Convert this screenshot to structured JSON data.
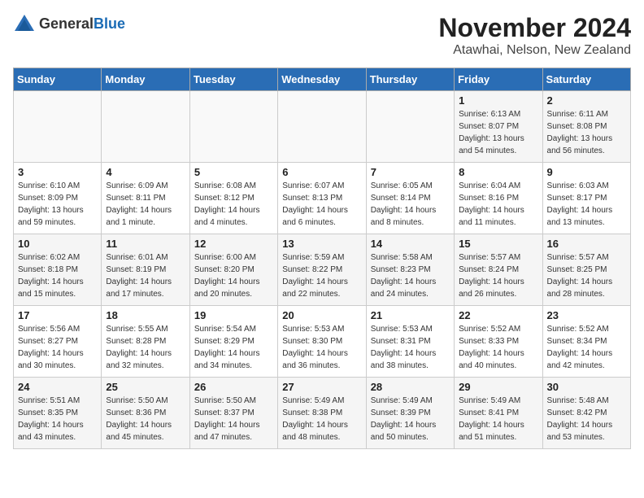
{
  "logo": {
    "text_general": "General",
    "text_blue": "Blue"
  },
  "title": "November 2024",
  "location": "Atawhai, Nelson, New Zealand",
  "days_of_week": [
    "Sunday",
    "Monday",
    "Tuesday",
    "Wednesday",
    "Thursday",
    "Friday",
    "Saturday"
  ],
  "weeks": [
    [
      {
        "day": "",
        "info": ""
      },
      {
        "day": "",
        "info": ""
      },
      {
        "day": "",
        "info": ""
      },
      {
        "day": "",
        "info": ""
      },
      {
        "day": "",
        "info": ""
      },
      {
        "day": "1",
        "info": "Sunrise: 6:13 AM\nSunset: 8:07 PM\nDaylight: 13 hours\nand 54 minutes."
      },
      {
        "day": "2",
        "info": "Sunrise: 6:11 AM\nSunset: 8:08 PM\nDaylight: 13 hours\nand 56 minutes."
      }
    ],
    [
      {
        "day": "3",
        "info": "Sunrise: 6:10 AM\nSunset: 8:09 PM\nDaylight: 13 hours\nand 59 minutes."
      },
      {
        "day": "4",
        "info": "Sunrise: 6:09 AM\nSunset: 8:11 PM\nDaylight: 14 hours\nand 1 minute."
      },
      {
        "day": "5",
        "info": "Sunrise: 6:08 AM\nSunset: 8:12 PM\nDaylight: 14 hours\nand 4 minutes."
      },
      {
        "day": "6",
        "info": "Sunrise: 6:07 AM\nSunset: 8:13 PM\nDaylight: 14 hours\nand 6 minutes."
      },
      {
        "day": "7",
        "info": "Sunrise: 6:05 AM\nSunset: 8:14 PM\nDaylight: 14 hours\nand 8 minutes."
      },
      {
        "day": "8",
        "info": "Sunrise: 6:04 AM\nSunset: 8:16 PM\nDaylight: 14 hours\nand 11 minutes."
      },
      {
        "day": "9",
        "info": "Sunrise: 6:03 AM\nSunset: 8:17 PM\nDaylight: 14 hours\nand 13 minutes."
      }
    ],
    [
      {
        "day": "10",
        "info": "Sunrise: 6:02 AM\nSunset: 8:18 PM\nDaylight: 14 hours\nand 15 minutes."
      },
      {
        "day": "11",
        "info": "Sunrise: 6:01 AM\nSunset: 8:19 PM\nDaylight: 14 hours\nand 17 minutes."
      },
      {
        "day": "12",
        "info": "Sunrise: 6:00 AM\nSunset: 8:20 PM\nDaylight: 14 hours\nand 20 minutes."
      },
      {
        "day": "13",
        "info": "Sunrise: 5:59 AM\nSunset: 8:22 PM\nDaylight: 14 hours\nand 22 minutes."
      },
      {
        "day": "14",
        "info": "Sunrise: 5:58 AM\nSunset: 8:23 PM\nDaylight: 14 hours\nand 24 minutes."
      },
      {
        "day": "15",
        "info": "Sunrise: 5:57 AM\nSunset: 8:24 PM\nDaylight: 14 hours\nand 26 minutes."
      },
      {
        "day": "16",
        "info": "Sunrise: 5:57 AM\nSunset: 8:25 PM\nDaylight: 14 hours\nand 28 minutes."
      }
    ],
    [
      {
        "day": "17",
        "info": "Sunrise: 5:56 AM\nSunset: 8:27 PM\nDaylight: 14 hours\nand 30 minutes."
      },
      {
        "day": "18",
        "info": "Sunrise: 5:55 AM\nSunset: 8:28 PM\nDaylight: 14 hours\nand 32 minutes."
      },
      {
        "day": "19",
        "info": "Sunrise: 5:54 AM\nSunset: 8:29 PM\nDaylight: 14 hours\nand 34 minutes."
      },
      {
        "day": "20",
        "info": "Sunrise: 5:53 AM\nSunset: 8:30 PM\nDaylight: 14 hours\nand 36 minutes."
      },
      {
        "day": "21",
        "info": "Sunrise: 5:53 AM\nSunset: 8:31 PM\nDaylight: 14 hours\nand 38 minutes."
      },
      {
        "day": "22",
        "info": "Sunrise: 5:52 AM\nSunset: 8:33 PM\nDaylight: 14 hours\nand 40 minutes."
      },
      {
        "day": "23",
        "info": "Sunrise: 5:52 AM\nSunset: 8:34 PM\nDaylight: 14 hours\nand 42 minutes."
      }
    ],
    [
      {
        "day": "24",
        "info": "Sunrise: 5:51 AM\nSunset: 8:35 PM\nDaylight: 14 hours\nand 43 minutes."
      },
      {
        "day": "25",
        "info": "Sunrise: 5:50 AM\nSunset: 8:36 PM\nDaylight: 14 hours\nand 45 minutes."
      },
      {
        "day": "26",
        "info": "Sunrise: 5:50 AM\nSunset: 8:37 PM\nDaylight: 14 hours\nand 47 minutes."
      },
      {
        "day": "27",
        "info": "Sunrise: 5:49 AM\nSunset: 8:38 PM\nDaylight: 14 hours\nand 48 minutes."
      },
      {
        "day": "28",
        "info": "Sunrise: 5:49 AM\nSunset: 8:39 PM\nDaylight: 14 hours\nand 50 minutes."
      },
      {
        "day": "29",
        "info": "Sunrise: 5:49 AM\nSunset: 8:41 PM\nDaylight: 14 hours\nand 51 minutes."
      },
      {
        "day": "30",
        "info": "Sunrise: 5:48 AM\nSunset: 8:42 PM\nDaylight: 14 hours\nand 53 minutes."
      }
    ]
  ]
}
